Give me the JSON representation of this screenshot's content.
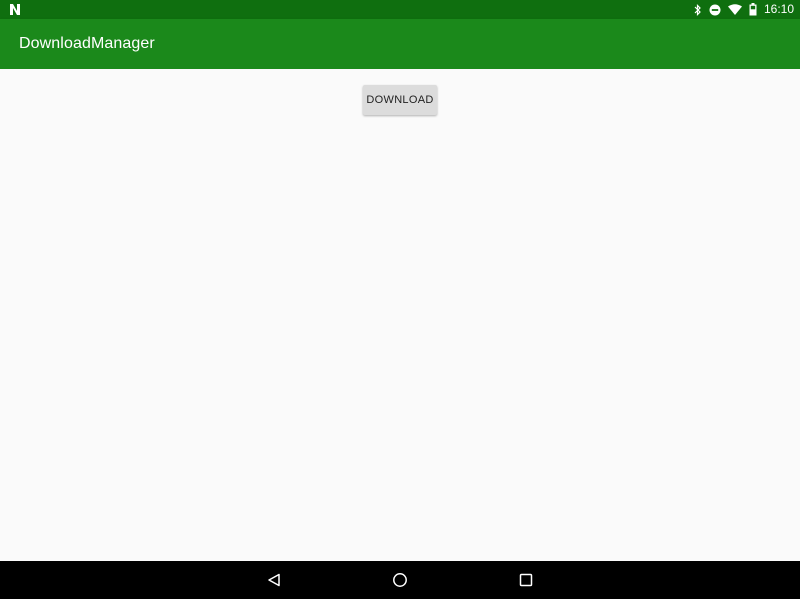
{
  "status_bar": {
    "time": "16:10",
    "icons": [
      "n-logo-icon",
      "bluetooth-icon",
      "do-not-disturb-icon",
      "wifi-icon",
      "battery-icon"
    ]
  },
  "app_bar": {
    "title": "DownloadManager"
  },
  "content": {
    "download_label": "DOWNLOAD"
  },
  "nav_bar": {
    "icons": [
      "back-icon",
      "home-icon",
      "recents-icon"
    ]
  },
  "colors": {
    "status_bar": "#0f6f0f",
    "app_bar": "#1b891b",
    "background": "#fafafa",
    "button": "#dcdcdc",
    "nav_bar": "#000000"
  }
}
